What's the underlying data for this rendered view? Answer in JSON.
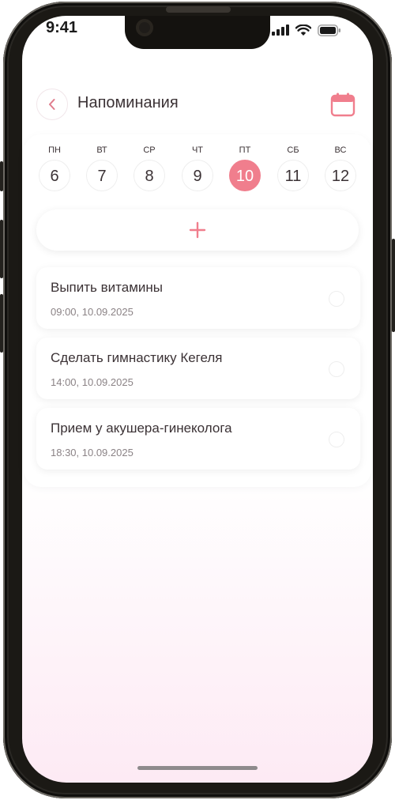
{
  "status_bar": {
    "time": "9:41"
  },
  "header": {
    "title": "Напоминания"
  },
  "week": {
    "days": [
      {
        "name": "ПН",
        "num": "6"
      },
      {
        "name": "ВТ",
        "num": "7"
      },
      {
        "name": "СР",
        "num": "8"
      },
      {
        "name": "ЧТ",
        "num": "9"
      },
      {
        "name": "ПТ",
        "num": "10"
      },
      {
        "name": "СБ",
        "num": "11"
      },
      {
        "name": "ВС",
        "num": "12"
      }
    ],
    "selected": "10"
  },
  "reminders": [
    {
      "title": "Выпить витамины",
      "datetime": "09:00, 10.09.2025"
    },
    {
      "title": "Сделать гимнастику Кегеля",
      "datetime": "14:00, 10.09.2025"
    },
    {
      "title": "Прием у акушера-гинеколога",
      "datetime": "18:30, 10.09.2025"
    }
  ],
  "icons": {
    "back": "chevron-left-icon",
    "calendar": "calendar-icon",
    "add": "plus-icon",
    "signal": "signal-icon",
    "wifi": "wifi-icon",
    "battery": "battery-icon"
  },
  "colors": {
    "accent": "#f07e8d",
    "text": "#3b3235",
    "muted": "#8b8386",
    "gradient_bottom": "#fdeaf4"
  }
}
